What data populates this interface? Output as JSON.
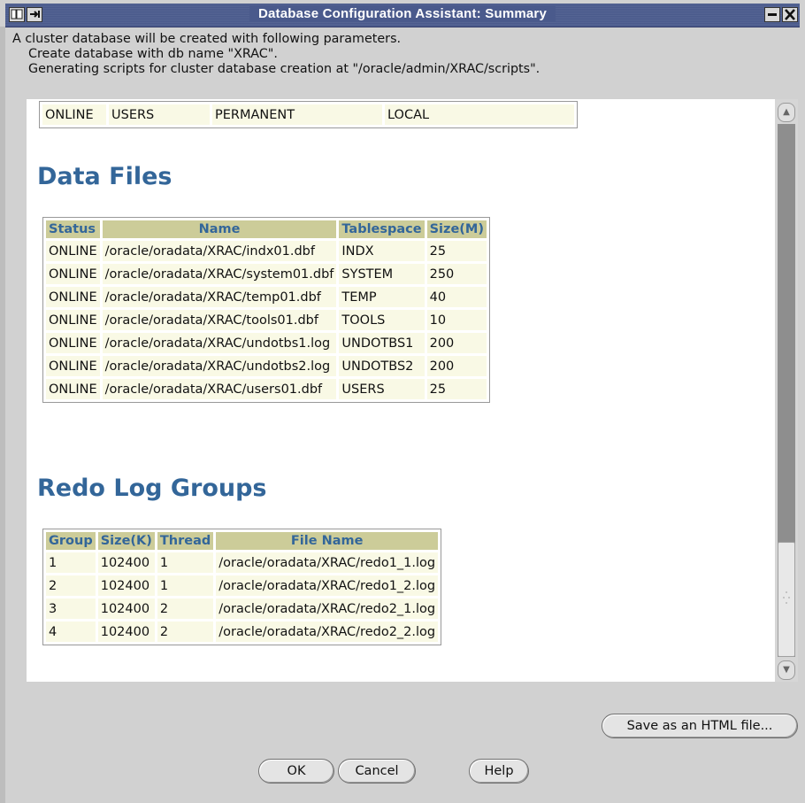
{
  "window": {
    "title": "Database Configuration Assistant: Summary",
    "icons": [
      "window-menu-icon",
      "minimize-icon",
      "close-icon"
    ]
  },
  "intro": {
    "line1": "A cluster database will be created with following parameters.",
    "line2": "Create database with db name \"XRAC\".",
    "line3": "Generating scripts for cluster database creation at \"/oracle/admin/XRAC/scripts\"."
  },
  "tablespace_row": [
    "ONLINE",
    "USERS",
    "PERMANENT",
    "LOCAL"
  ],
  "data_files": {
    "heading": "Data Files",
    "columns": [
      "Status",
      "Name",
      "Tablespace",
      "Size(M)"
    ],
    "rows": [
      [
        "ONLINE",
        "/oracle/oradata/XRAC/indx01.dbf",
        "INDX",
        "25"
      ],
      [
        "ONLINE",
        "/oracle/oradata/XRAC/system01.dbf",
        "SYSTEM",
        "250"
      ],
      [
        "ONLINE",
        "/oracle/oradata/XRAC/temp01.dbf",
        "TEMP",
        "40"
      ],
      [
        "ONLINE",
        "/oracle/oradata/XRAC/tools01.dbf",
        "TOOLS",
        "10"
      ],
      [
        "ONLINE",
        "/oracle/oradata/XRAC/undotbs1.log",
        "UNDOTBS1",
        "200"
      ],
      [
        "ONLINE",
        "/oracle/oradata/XRAC/undotbs2.log",
        "UNDOTBS2",
        "200"
      ],
      [
        "ONLINE",
        "/oracle/oradata/XRAC/users01.dbf",
        "USERS",
        "25"
      ]
    ]
  },
  "redo_logs": {
    "heading": "Redo Log Groups",
    "columns": [
      "Group",
      "Size(K)",
      "Thread",
      "File Name"
    ],
    "rows": [
      [
        "1",
        "102400",
        "1",
        "/oracle/oradata/XRAC/redo1_1.log"
      ],
      [
        "2",
        "102400",
        "1",
        "/oracle/oradata/XRAC/redo1_2.log"
      ],
      [
        "3",
        "102400",
        "2",
        "/oracle/oradata/XRAC/redo2_1.log"
      ],
      [
        "4",
        "102400",
        "2",
        "/oracle/oradata/XRAC/redo2_2.log"
      ]
    ]
  },
  "buttons": {
    "save_html": "Save as an HTML file...",
    "ok": "OK",
    "cancel": "Cancel",
    "help": "Help"
  },
  "colors": {
    "heading": "#336699",
    "header_cell": "#cccc99",
    "data_cell": "#f9f9e5",
    "titlebar": "#4a5a8c"
  }
}
